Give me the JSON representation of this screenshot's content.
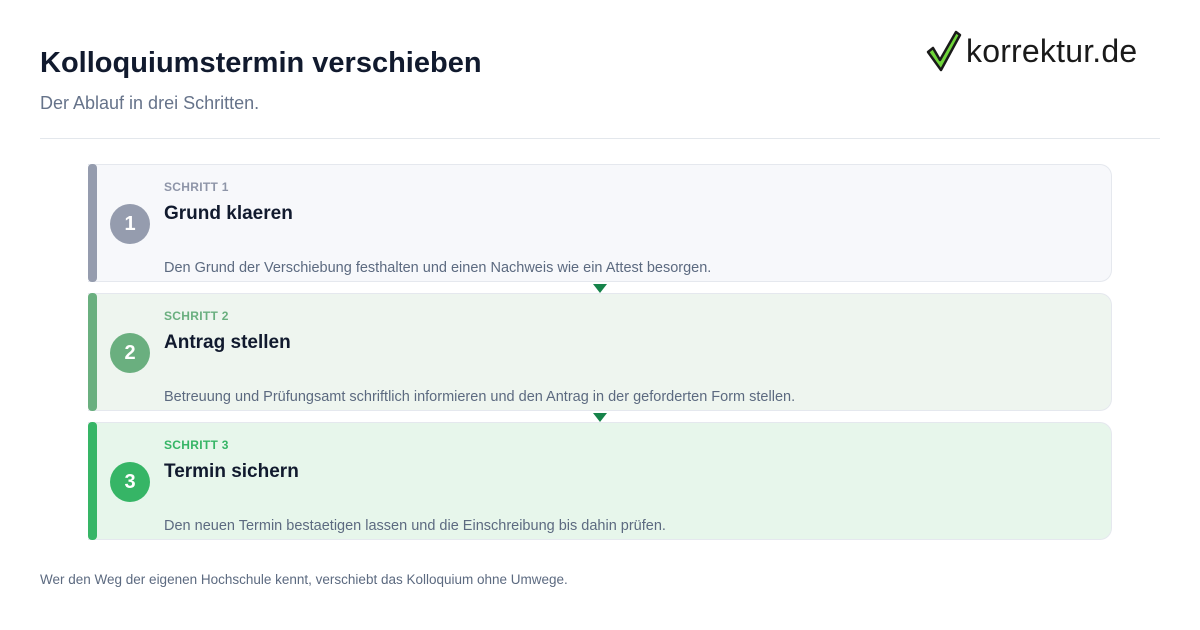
{
  "header": {
    "title": "Kolloquiumstermin verschieben",
    "subtitle": "Der Ablauf in drei Schritten."
  },
  "logo": {
    "text": "korrektur.de",
    "icon": "checkmark-icon",
    "check_color": "#6fd63a"
  },
  "steps": [
    {
      "number": "1",
      "kicker": "SCHRITT 1",
      "title": "Grund klaeren",
      "description": "Den Grund der Verschiebung festhalten und einen Nachweis wie ein Attest besorgen.",
      "color": "#959cae"
    },
    {
      "number": "2",
      "kicker": "SCHRITT 2",
      "title": "Antrag stellen",
      "description": "Betreuung und Prüfungsamt schriftlich informieren und den Antrag in der geforderten Form stellen.",
      "color": "#6aaf7f"
    },
    {
      "number": "3",
      "kicker": "SCHRITT 3",
      "title": "Termin sichern",
      "description": "Den neuen Termin bestaetigen lassen und die Einschreibung bis dahin prüfen.",
      "color": "#36b566"
    }
  ],
  "connector_color": "#16834a",
  "footer": {
    "text": "Wer den Weg der eigenen Hochschule kennt, verschiebt das Kolloquium ohne Umwege."
  }
}
